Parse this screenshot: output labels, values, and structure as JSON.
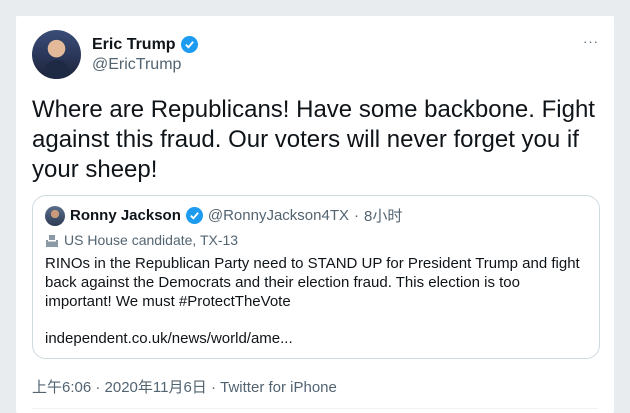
{
  "tweet": {
    "display_name": "Eric Trump",
    "handle": "@EricTrump",
    "text": "Where are Republicans! Have some backbone. Fight against this fraud. Our voters will never forget you if your sheep!",
    "more_label": "···",
    "footer": "上午6:06 · 2020年11月6日 · Twitter for iPhone"
  },
  "quoted": {
    "display_name": "Ronny Jackson",
    "handle": "@RonnyJackson4TX",
    "separator": "·",
    "time": "8小时",
    "label": "US House candidate, TX-13",
    "text": "RINOs in the Republican Party need to STAND UP for President Trump and fight back against the Democrats and their election fraud. This election is too important! We must #ProtectTheVote",
    "link": "independent.co.uk/news/world/ame..."
  },
  "colors": {
    "verified": "#1d9bf0",
    "secondary_text": "#536471",
    "border": "#cfd9de"
  },
  "icons": {
    "verified": "verified-badge-icon",
    "more": "more-dots-icon",
    "label": "ballot-box-icon"
  }
}
